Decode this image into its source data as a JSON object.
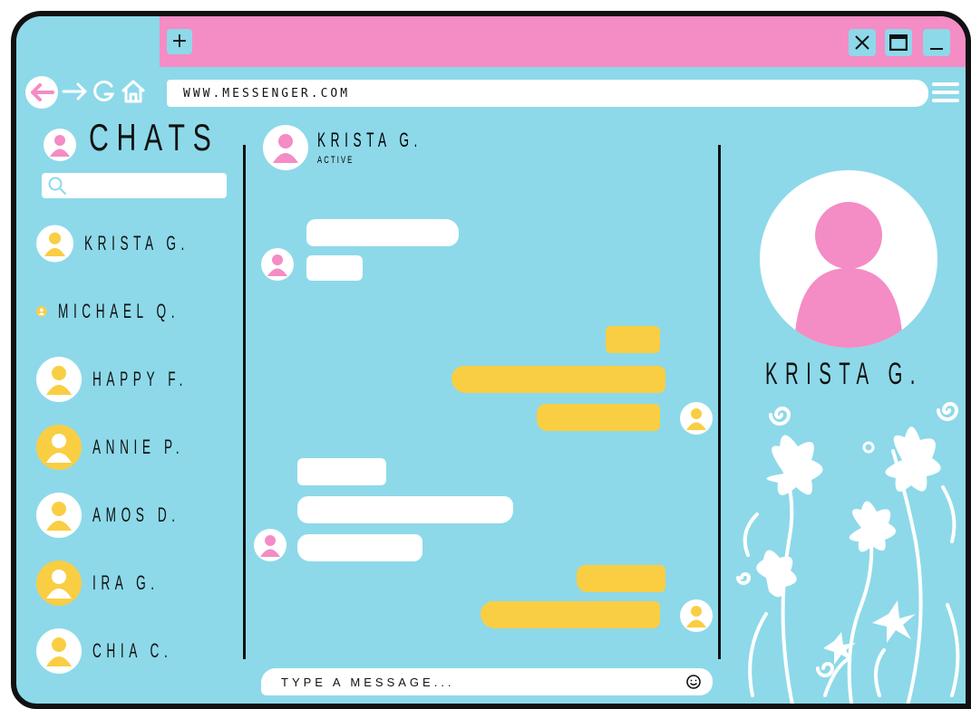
{
  "browser": {
    "url": "WWW.MESSENGER.COM",
    "new_tab_label": "+",
    "accent_pink": "#f48cc5",
    "accent_blue": "#8dd9e9",
    "accent_yellow": "#f9ce43"
  },
  "sidebar": {
    "title": "CHATS",
    "search_placeholder": "",
    "contacts": [
      {
        "name": "KRISTA G.",
        "avatar": "yellow-bg-person-icon"
      },
      {
        "name": "MICHAEL Q.",
        "avatar": "white-bg-person-icon"
      },
      {
        "name": "HAPPY F.",
        "avatar": "yellow-bg-person-icon"
      },
      {
        "name": "ANNIE P.",
        "avatar": "white-bg-person-icon"
      },
      {
        "name": "AMOS D.",
        "avatar": "yellow-bg-person-icon"
      },
      {
        "name": "IRA G.",
        "avatar": "white-bg-person-icon"
      },
      {
        "name": "CHIA C.",
        "avatar": "yellow-bg-person-icon"
      }
    ]
  },
  "chat": {
    "contact_name": "KRISTA G.",
    "status": "ACTIVE",
    "input_placeholder": "TYPE A MESSAGE..."
  },
  "profile": {
    "name": "KRISTA G."
  }
}
